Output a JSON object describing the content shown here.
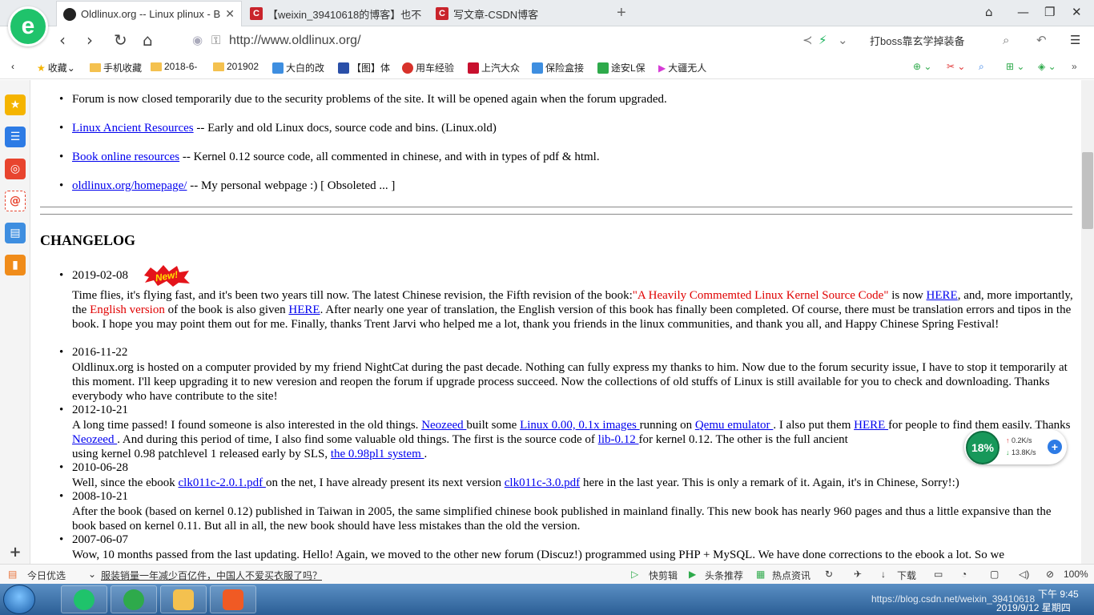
{
  "browser": {
    "tabs": [
      {
        "title": "Oldlinux.org -- Linux plinux - B"
      },
      {
        "title": "【weixin_39410618的博客】也不"
      },
      {
        "title": "写文章-CSDN博客"
      }
    ],
    "url": "http://www.oldlinux.org/",
    "search_text": "打boss靠玄学掉装备"
  },
  "bookmarks": [
    "收藏",
    "手机收藏",
    "2018-6-",
    "201902",
    "大白的改",
    "【图】体",
    "用车经验",
    "上汽大众",
    "保险盒接",
    "途安L保",
    "大疆无人"
  ],
  "page": {
    "resources": [
      {
        "pre": "",
        "link": "",
        "post": "Forum is now closed temporarily due to the security problems of the site. It will be opened again when the forum upgraded."
      },
      {
        "pre": "",
        "link": "Linux Ancient Resources",
        "post": " -- Early and old Linux docs, source code and bins. (Linux.old)"
      },
      {
        "pre": "",
        "link": "Book online resources",
        "post": " -- Kernel 0.12 source code, all commented in chinese, and with in types of pdf & html."
      },
      {
        "pre": "",
        "link": "oldlinux.org/homepage/",
        "post": " -- My personal webpage :) [ Obsoleted ... ]"
      }
    ],
    "changelog_title": "CHANGELOG",
    "new_badge": "New!",
    "entries": {
      "e1_date": "2019-02-08",
      "e1_t1": "Time flies, it's flying fast, and it's been two years till now. The latest Chinese revision, the Fifth revision of the book:",
      "e1_red1": "\"A Heavily Commemted Linux Kernel Source Code\"",
      "e1_t2": " is now ",
      "e1_l1": "HERE",
      "e1_t3": ", and, more importantly, the ",
      "e1_red2": "English version",
      "e1_t4": " of the book is also given ",
      "e1_l2": "HERE",
      "e1_t5": ". After nearly one year of translation, the English version of this book has finally been completed. Of course, there must be translation errors and tipos in the book. I hope you may point them out for me. Finally, thanks Trent Jarvi who helped me a lot, thank you friends in the linux communities, and thank you all, and Happy Chinese Spring Festival!",
      "e2_date": "2016-11-22",
      "e2_t1": "Oldlinux.org is hosted on a computer provided by my friend NightCat during the past decade. Nothing can fully express my thanks to him. Now due to the forum security issue, I have to stop it temporarily at this moment. I'll keep upgrading it to new veresion and reopen the forum if upgrade process succeed. Now the collections of old stuffs of Linux is still available for you to check and downloading. Thanks everybody who have contribute to the site!",
      "e3_date": "2012-10-21",
      "e3_t1": "A long time passed! I found someone is also interested in the old things. ",
      "e3_l1": "Neozeed ",
      "e3_t2": "built some ",
      "e3_l2": "Linux 0.00, 0.1x images ",
      "e3_t3": "running on ",
      "e3_l3": "Qemu emulator ",
      "e3_t4": ". I also put them ",
      "e3_l4": "HERE ",
      "e3_t5": "for people to find them easily. Thanks ",
      "e3_l5": "Neozeed ",
      "e3_t6": ". And during this period of time, I also find some valuable old things. The first is the source code of ",
      "e3_l6": "lib-0.12 ",
      "e3_t7": "for kernel 0.12. The other is the full ancient",
      "e3_t8": "using kernel 0.98 patchlevel 1 released early by SLS, ",
      "e3_l7": "the 0.98pl1 system ",
      "e3_t9": ".",
      "e4_date": "2010-06-28",
      "e4_t1": "Well, since the ebook ",
      "e4_l1": "clk011c-2.0.1.pdf ",
      "e4_t2": "on the net, I have already present its next version ",
      "e4_l2": "clk011c-3.0.pdf",
      "e4_t3": " here in the last year. This is only a remark of it. Again, it's in Chinese, Sorry!:)",
      "e5_date": "2008-10-21",
      "e5_t1": "After the book (based on kernel 0.12) published in Taiwan in 2005, the same simplified chinese book published in mainland finally. This new book has nearly 960 pages and thus a little expansive than the book based on kernel 0.11. But all in all, the new book should have less mistakes than the old the version.",
      "e6_date": "2007-06-07",
      "e6_t1": "Wow, 10 months passed from the last updating. Hello! Again, we moved to the other new forum (Discuz!) programmed using PHP + MySQL. We have done corrections to the ebook a lot. So we"
    }
  },
  "status": {
    "left": "今日优选",
    "news": "服装销量一年减少百亿件，中国人不爱买衣服了吗？",
    "items": [
      "快剪辑",
      "头条推荐",
      "热点资讯",
      "下载",
      "100%"
    ]
  },
  "speed_widget": {
    "percent": "18%",
    "up": "0.2K/s",
    "down": "13.8K/s"
  },
  "taskbar": {
    "time": "下午 9:45",
    "date": "2019/9/12 星期四",
    "watermark": "https://blog.csdn.net/weixin_39410618"
  }
}
